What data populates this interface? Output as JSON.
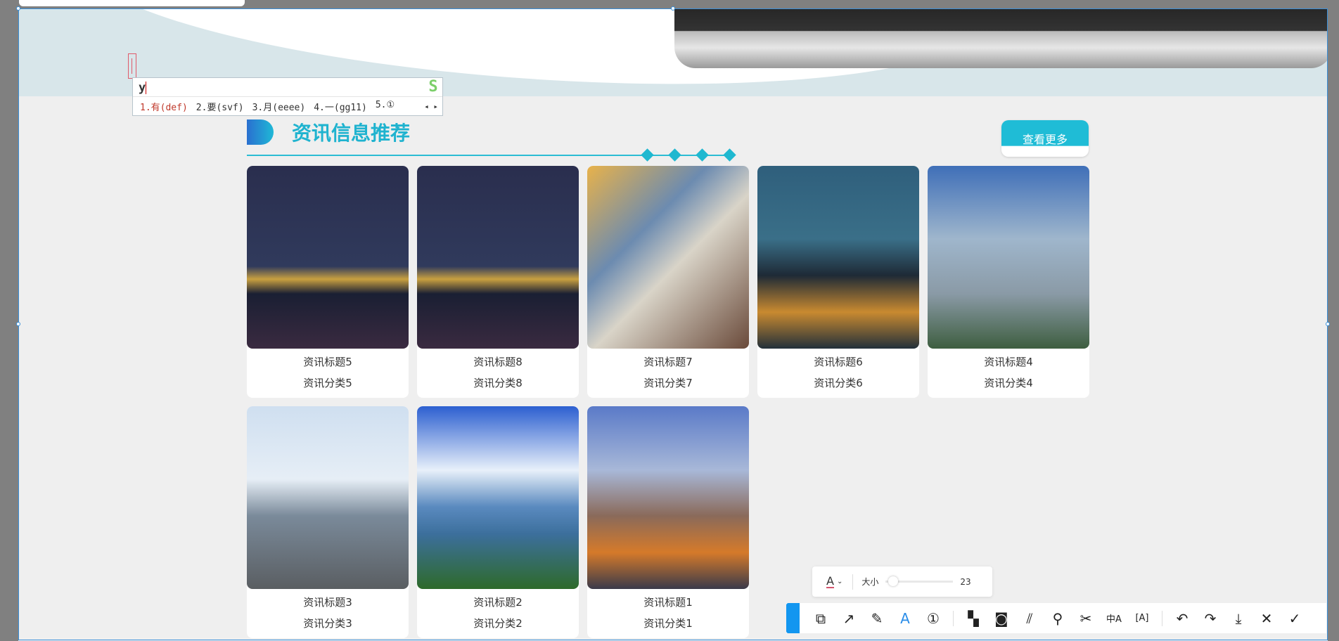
{
  "ime": {
    "composition": "y",
    "candidates": [
      "1.有(def)",
      "2.要(svf)",
      "3.月(eeee)",
      "4.一(gg11)",
      "5.①"
    ],
    "logo": "S"
  },
  "section": {
    "title": "资讯信息推荐",
    "more_label": "查看更多",
    "accent": "#1fb8d0"
  },
  "cards": [
    {
      "title": "资讯标题5",
      "category": "资讯分类5",
      "img": "linear-gradient(#2a2e4e 0%,#303a5c 55%,#c9a040 62%,#1a1f33 70%,#3a2a40 100%)"
    },
    {
      "title": "资讯标题8",
      "category": "资讯分类8",
      "img": "linear-gradient(#2a2e4e 0%,#303a5c 55%,#c9a040 62%,#1a1f33 70%,#3a2a40 100%)"
    },
    {
      "title": "资讯标题7",
      "category": "资讯分类7",
      "img": "linear-gradient(135deg,#e8b24a 0%,#6c8bb0 35%,#d9d4c8 55%,#6a4a3a 100%)"
    },
    {
      "title": "资讯标题6",
      "category": "资讯分类6",
      "img": "linear-gradient(#2f5f7c 0%,#3a6f88 40%,#1e2a36 60%,#c98a30 80%,#22303a 100%)"
    },
    {
      "title": "资讯标题4",
      "category": "资讯分类4",
      "img": "linear-gradient(#3f6fb8 0%,#9fb6cc 40%,#8a9aa6 70%,#3e5e40 100%)"
    },
    {
      "title": "资讯标题3",
      "category": "资讯分类3",
      "img": "linear-gradient(#cfdff0 0%,#e6eef6 40%,#7a8a9a 60%,#5a5e62 100%)"
    },
    {
      "title": "资讯标题2",
      "category": "资讯分类2",
      "img": "linear-gradient(#2c5fd0 0%,#e8f0fa 35%,#5a8abf 55%,#3c6f9c 70%,#2e6a2a 100%)"
    },
    {
      "title": "资讯标题1",
      "category": "资讯分类1",
      "img": "linear-gradient(#5a7ac8 0%,#a8b8d8 35%,#8a6a5a 60%,#d57a2a 80%,#3a3a4a 100%)"
    }
  ],
  "text_options": {
    "font_icon": "A",
    "size_label": "大小",
    "size_value": "23",
    "size_fraction": 0.05,
    "color": "#d4556e"
  },
  "toolbar": {
    "tools": [
      {
        "name": "shape",
        "glyph": "⧉"
      },
      {
        "name": "arrow",
        "glyph": "↗"
      },
      {
        "name": "pen",
        "glyph": "✎"
      },
      {
        "name": "text",
        "glyph": "A",
        "active": true
      },
      {
        "name": "number",
        "glyph": "①"
      },
      {
        "name": "mosaic",
        "glyph": "▚"
      },
      {
        "name": "blur",
        "glyph": "◙"
      },
      {
        "name": "hatch",
        "glyph": "⫽"
      },
      {
        "name": "pin",
        "glyph": "⚲"
      },
      {
        "name": "cut",
        "glyph": "✂"
      },
      {
        "name": "translate",
        "glyph": "中A"
      },
      {
        "name": "ocr",
        "glyph": "[A]"
      },
      {
        "name": "undo",
        "glyph": "↶"
      },
      {
        "name": "redo",
        "glyph": "↷"
      },
      {
        "name": "download",
        "glyph": "⤓"
      },
      {
        "name": "close",
        "glyph": "✕"
      },
      {
        "name": "confirm",
        "glyph": "✓"
      }
    ],
    "accent": "#1296f0"
  }
}
